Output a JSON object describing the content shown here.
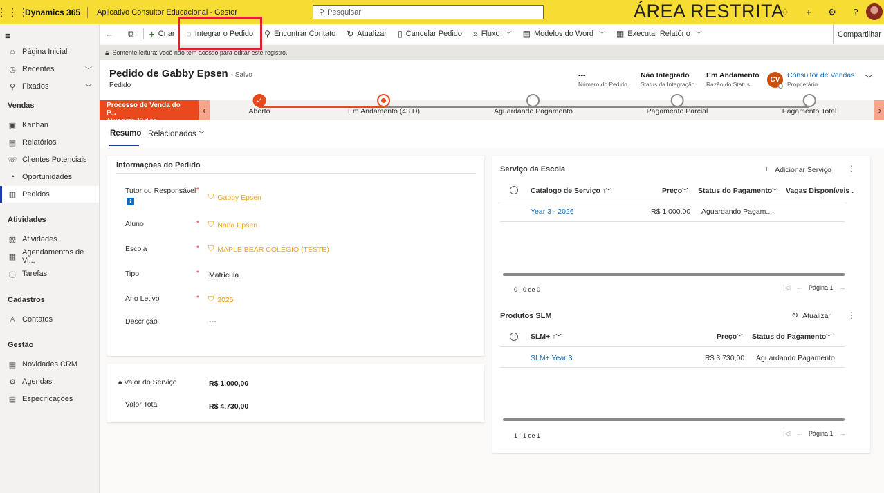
{
  "topbar": {
    "brand": "Dynamics 365",
    "app_name": "Aplicativo Consultor Educacional - Gestor",
    "search_placeholder": "Pesquisar",
    "restricted_banner": "ÁREA RESTRITA",
    "icons": [
      "lightbulb-icon",
      "plus-icon",
      "settings-icon",
      "help-icon"
    ]
  },
  "command_bar": {
    "criar": "Criar",
    "integrar": "Integrar o Pedido",
    "encontrar": "Encontrar Contato",
    "atualizar": "Atualizar",
    "cancelar": "Cancelar Pedido",
    "fluxo": "Fluxo",
    "modelos": "Modelos do Word",
    "executar": "Executar Relatório",
    "compartilhar": "Compartilhar"
  },
  "readonly_notice": "Somente leitura: você não tem acesso para editar este registro.",
  "nav": {
    "items_top": [
      {
        "label": "Página Inicial",
        "icon": "home-icon"
      },
      {
        "label": "Recentes",
        "icon": "clock-icon"
      },
      {
        "label": "Fixados",
        "icon": "pin-icon"
      }
    ],
    "groups": [
      {
        "title": "Vendas",
        "items": [
          {
            "label": "Kanban",
            "icon": "kanban-icon"
          },
          {
            "label": "Relatórios",
            "icon": "reports-icon"
          },
          {
            "label": "Clientes Potenciais",
            "icon": "leads-icon"
          },
          {
            "label": "Oportunidades",
            "icon": "opportunities-icon"
          },
          {
            "label": "Pedidos",
            "icon": "orders-icon"
          }
        ]
      },
      {
        "title": "Atividades",
        "items": [
          {
            "label": "Atividades",
            "icon": "activities-icon"
          },
          {
            "label": "Agendamentos de Vi...",
            "icon": "calendar-icon"
          },
          {
            "label": "Tarefas",
            "icon": "tasks-icon"
          }
        ]
      },
      {
        "title": "Cadastros",
        "items": [
          {
            "label": "Contatos",
            "icon": "contact-icon"
          }
        ]
      },
      {
        "title": "Gestão",
        "items": [
          {
            "label": "Novidades CRM",
            "icon": "news-icon"
          },
          {
            "label": "Agendas",
            "icon": "agenda-icon"
          },
          {
            "label": "Especificações",
            "icon": "specs-icon"
          }
        ]
      }
    ]
  },
  "record": {
    "title": "Pedido de Gabby Epsen",
    "saved": "- Salvo",
    "entity": "Pedido",
    "fields": [
      {
        "value": "---",
        "label": "Número do Pedido"
      },
      {
        "value": "Não Integrado",
        "label": "Status da Integração"
      },
      {
        "value": "Em Andamento",
        "label": "Razão do Status"
      }
    ],
    "owner_initials": "CV",
    "owner_name": "Consultor de Vendas",
    "owner_label": "Proprietário"
  },
  "bpf": {
    "title": "Processo de Venda do P...",
    "subtitle": "Ativo para 43 dias",
    "stages": [
      {
        "label": "Aberto",
        "state": "done"
      },
      {
        "label": "Em Andamento  (43 D)",
        "state": "active"
      },
      {
        "label": "Aguardando Pagamento",
        "state": "pending"
      },
      {
        "label": "Pagamento Parcial",
        "state": "pending"
      },
      {
        "label": "Pagamento Total",
        "state": "pending"
      }
    ]
  },
  "tabs": {
    "resumo": "Resumo",
    "relacionados": "Relacionados"
  },
  "order_info": {
    "title": "Informações do Pedido",
    "tutor_label": "Tutor ou Responsável",
    "tutor_value": "Gabby Epsen",
    "aluno_label": "Aluno",
    "aluno_value": "Nana Epsen",
    "escola_label": "Escola",
    "escola_value": "MAPLE BEAR COLÉGIO (TESTE)",
    "tipo_label": "Tipo",
    "tipo_value": "Matrícula",
    "ano_label": "Ano Letivo",
    "ano_value": "2025",
    "descricao_label": "Descrição",
    "descricao_value": "---",
    "required_mark": "*"
  },
  "values": {
    "servico_label": "Valor do Serviço",
    "servico_value": "R$ 1.000,00",
    "total_label": "Valor Total",
    "total_value": "R$ 4.730,00"
  },
  "servico_escola": {
    "title": "Serviço da Escola",
    "add_label": "Adicionar Serviço",
    "headers": [
      "Catalogo de Serviço",
      "Preço",
      "Status do Pagamento",
      "Vagas Disponíveis ."
    ],
    "row": {
      "catalogo": "Year 3 - 2026",
      "preco": "R$ 1.000,00",
      "status": "Aguardando Pagam..."
    },
    "count": "0 - 0 de 0",
    "page": "Página 1"
  },
  "produtos_slm": {
    "title": "Produtos SLM",
    "refresh_label": "Atualizar",
    "headers": [
      "SLM+",
      "Preço",
      "Status do Pagamento"
    ],
    "row": {
      "slm": "SLM+ Year 3",
      "preco": "R$ 3.730,00",
      "status": "Aguardando Pagamento"
    },
    "count": "1 - 1 de 1",
    "page": "Página 1"
  },
  "colors": {
    "accent": "#e9491c",
    "topbar": "#f7dd33",
    "link": "#0f6cbd",
    "lookup": "#f3a31c",
    "highlight": "#e0202d"
  }
}
